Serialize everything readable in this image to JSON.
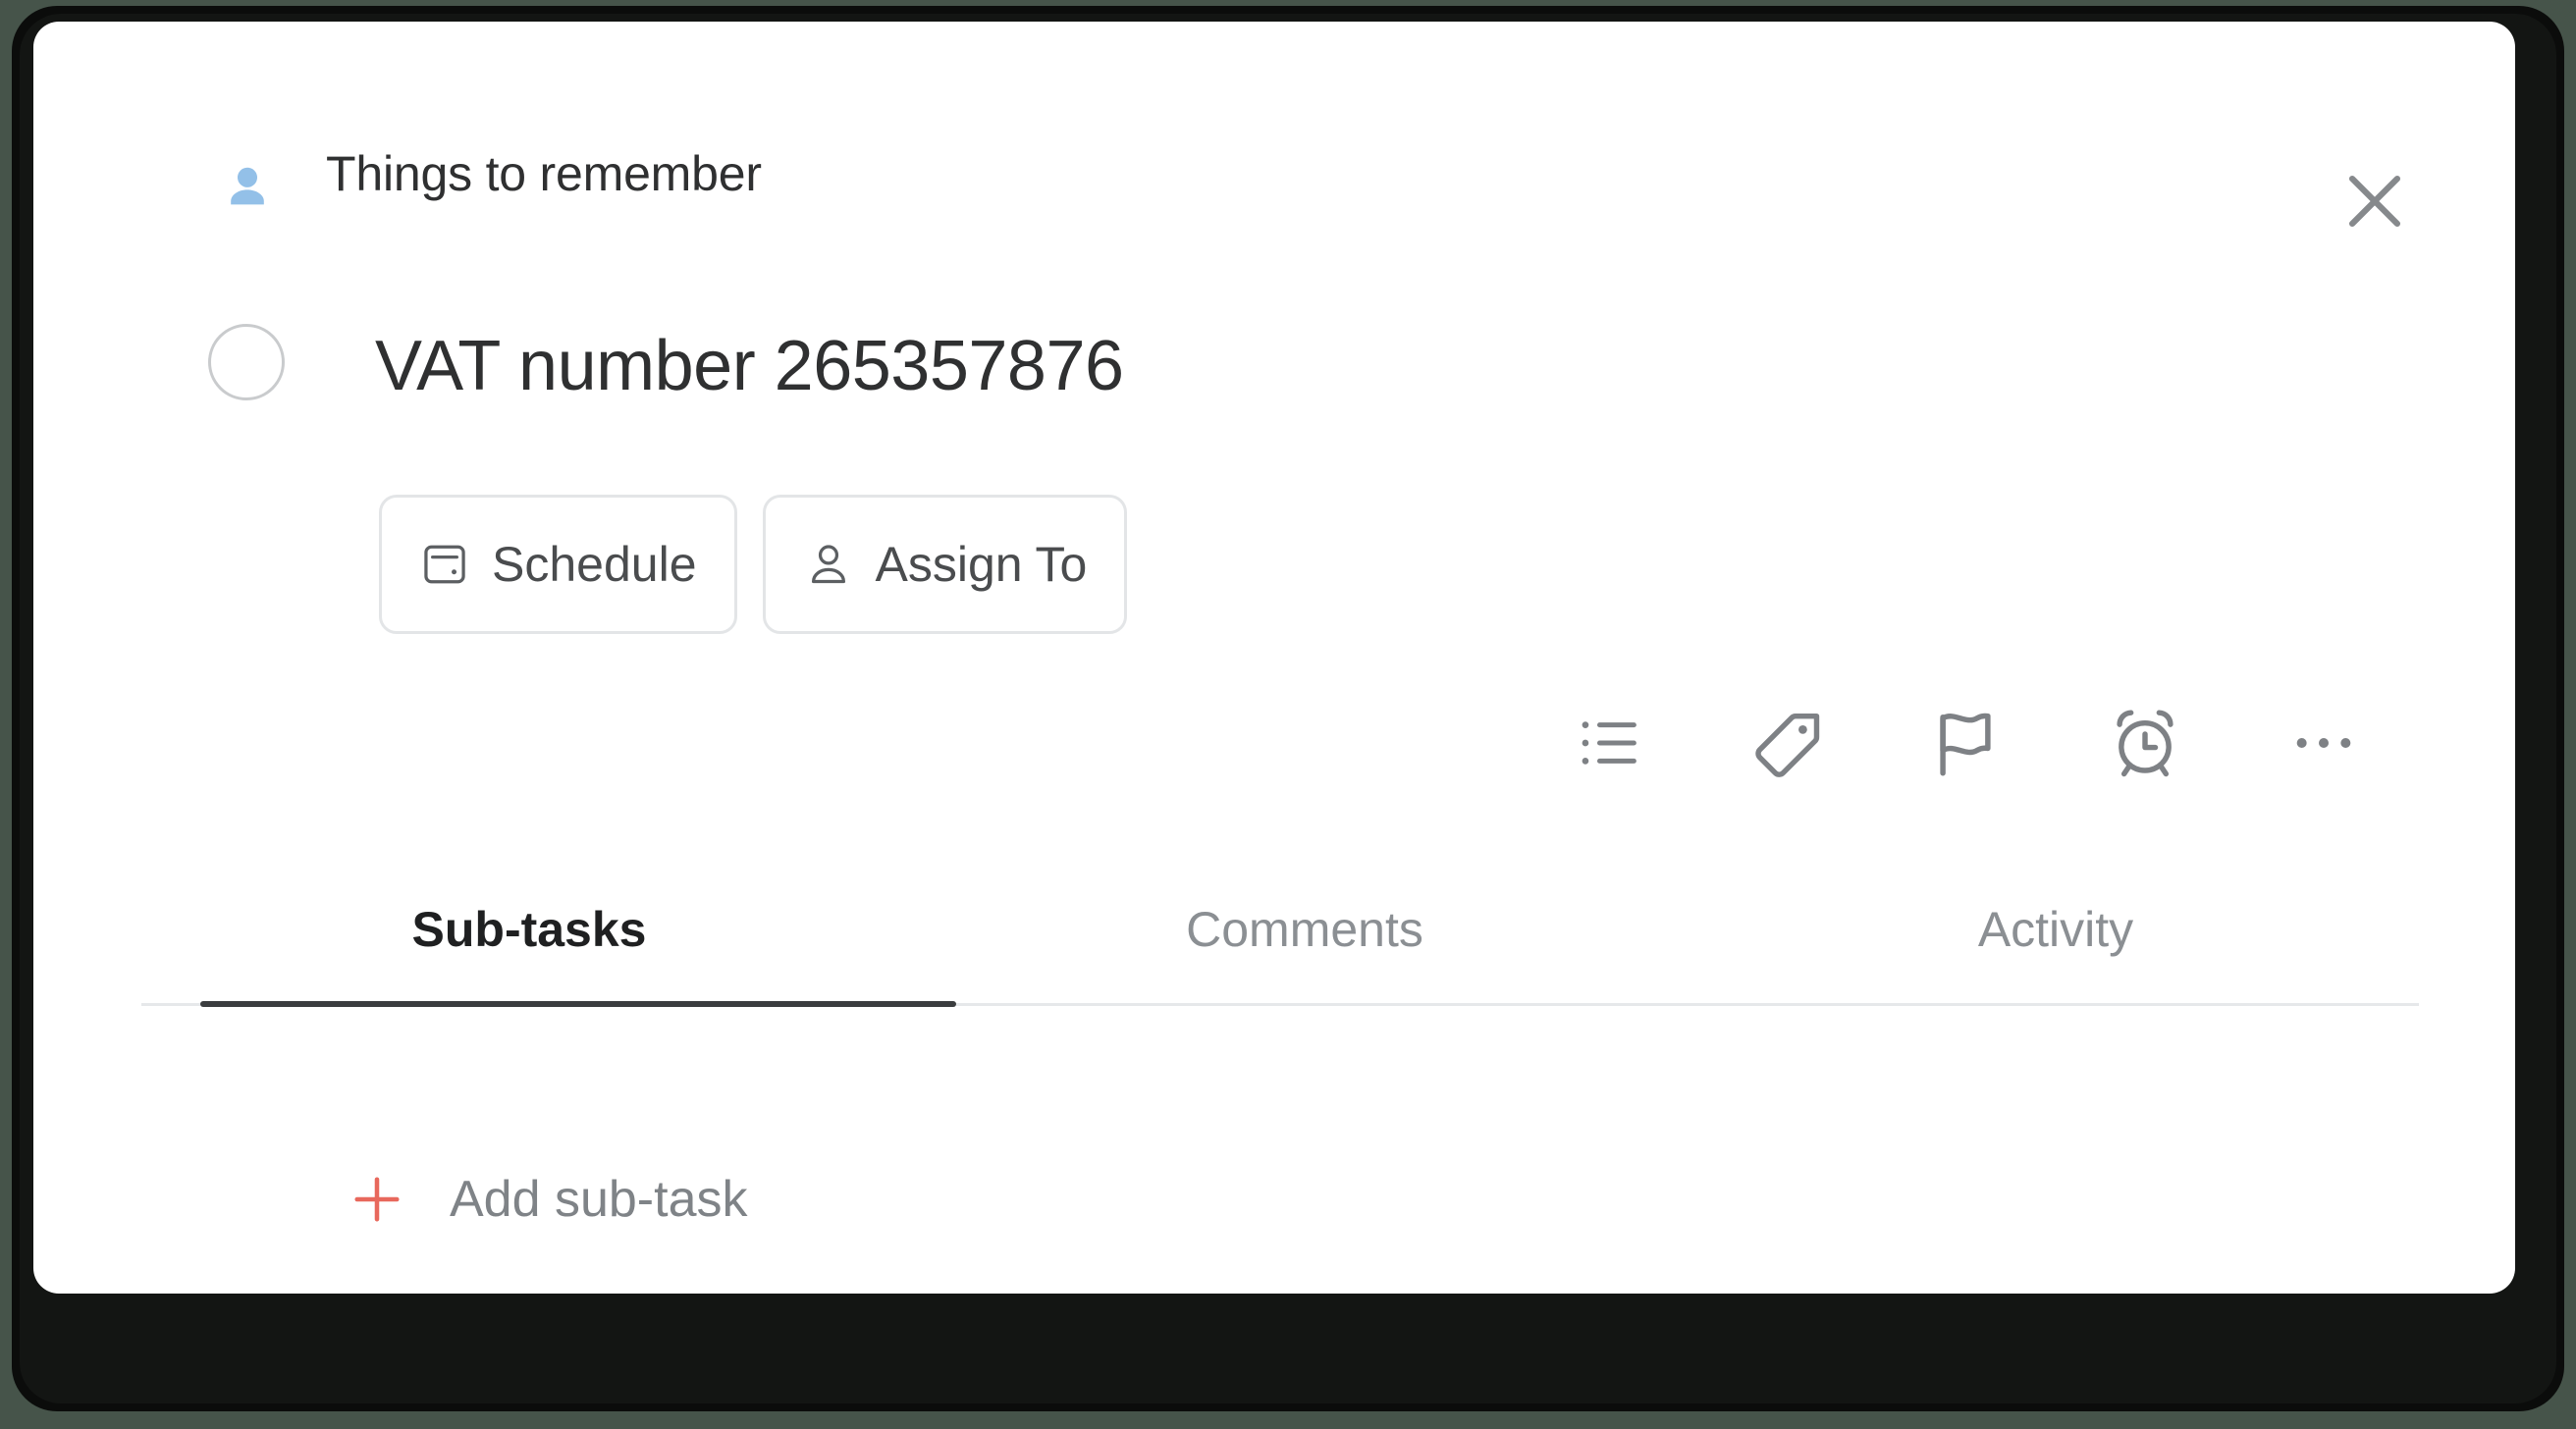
{
  "window": {
    "background_color": "#46544a",
    "card_background": "#ffffff"
  },
  "header": {
    "icon": "person-filled-icon",
    "icon_color": "#93c0e8",
    "title": "Things to remember",
    "close_icon": "close-icon"
  },
  "task": {
    "checkbox_state": "unchecked",
    "title": "VAT number 265357876"
  },
  "actions": [
    {
      "label": "Schedule",
      "icon": "calendar-icon"
    },
    {
      "label": "Assign To",
      "icon": "person-outline-icon"
    }
  ],
  "toolbar": {
    "icons": [
      "list-icon",
      "tag-icon",
      "flag-icon",
      "alarm-clock-icon",
      "more-horizontal-icon"
    ]
  },
  "tabs": {
    "active_index": 0,
    "items": [
      {
        "label": "Sub-tasks"
      },
      {
        "label": "Comments"
      },
      {
        "label": "Activity"
      }
    ],
    "accent_color": "#3b3d3f"
  },
  "footer": {
    "add_label": "Add sub-task",
    "plus_icon": "plus-icon",
    "plus_color": "#e8685c"
  }
}
